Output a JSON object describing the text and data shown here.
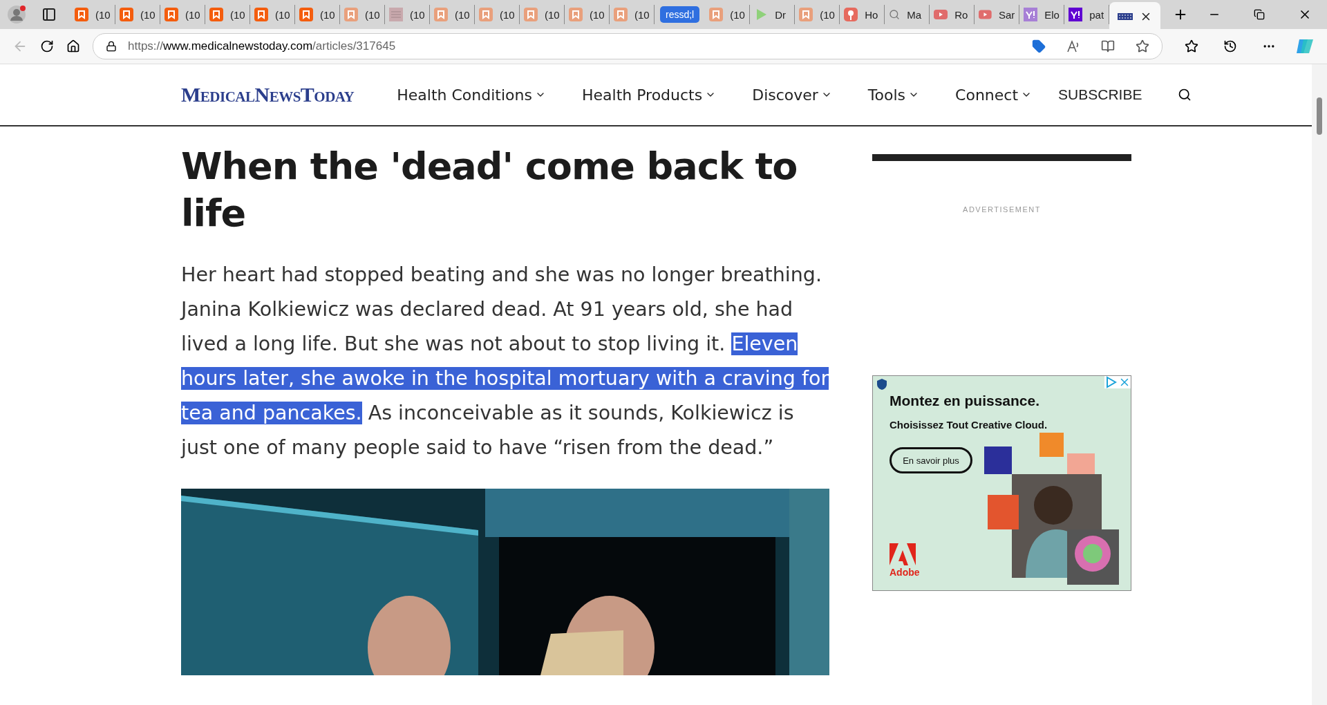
{
  "tabs": [
    {
      "kind": "bookmark",
      "label": "(10",
      "selected": false
    },
    {
      "kind": "bookmark",
      "label": "(10",
      "selected": false
    },
    {
      "kind": "bookmark",
      "label": "(10",
      "selected": false
    },
    {
      "kind": "bookmark",
      "label": "(10",
      "selected": false
    },
    {
      "kind": "bookmark",
      "label": "(10",
      "selected": false
    },
    {
      "kind": "bookmark",
      "label": "(10",
      "selected": false
    },
    {
      "kind": "faded",
      "label": "(10",
      "selected": false
    },
    {
      "kind": "thumbnail",
      "label": "(10",
      "selected": false
    },
    {
      "kind": "faded",
      "label": "(10",
      "selected": false
    },
    {
      "kind": "faded",
      "label": "(10",
      "selected": false
    },
    {
      "kind": "faded",
      "label": "(10",
      "selected": false
    },
    {
      "kind": "faded",
      "label": "(10",
      "selected": false
    },
    {
      "kind": "faded",
      "label": "(10",
      "selected": false
    },
    {
      "kind": "group",
      "label": "ressd;l",
      "selected": false
    },
    {
      "kind": "faded",
      "label": "(10",
      "selected": false
    },
    {
      "kind": "play",
      "label": "Dr",
      "selected": false
    },
    {
      "kind": "faded",
      "label": "(10",
      "selected": false
    },
    {
      "kind": "pin",
      "label": "Ho",
      "selected": false
    },
    {
      "kind": "search",
      "label": "Ma",
      "selected": false
    },
    {
      "kind": "video",
      "label": "Ro",
      "selected": false
    },
    {
      "kind": "video",
      "label": "Sar",
      "selected": false
    },
    {
      "kind": "light",
      "label": "Elo",
      "selected": false
    },
    {
      "kind": "yahoo",
      "label": "pat",
      "selected": false
    },
    {
      "kind": "site",
      "selected": true
    }
  ],
  "address_bar": {
    "scheme": "https://",
    "host": "www.medicalnewstoday.com",
    "path": "/articles/317645"
  },
  "site": {
    "logo": "MedicalNewsToday",
    "nav": [
      "Health Conditions",
      "Health Products",
      "Discover",
      "Tools",
      "Connect"
    ],
    "subscribe": "SUBSCRIBE"
  },
  "article": {
    "title": "When the 'dead' come back to life",
    "paragraph": [
      {
        "text": "Her heart had stopped beating and she was no longer breathing. Janina Kolkiewicz was declared dead. At 91 years old, she had lived a long life. But she was not about to stop living it. ",
        "selected": false
      },
      {
        "text": "Eleven hours later, she awoke in the hospital mortuary with a craving for tea and pancakes.",
        "selected": true
      },
      {
        "text": " As inconceivable as it sounds, Kolkiewicz is just one of many people said to have “risen from the dead.”",
        "selected": false
      }
    ]
  },
  "sidebar": {
    "ad_label": "ADVERTISEMENT",
    "ad": {
      "headline": "Montez en puissance.",
      "subline": "Choisissez Tout Creative Cloud.",
      "button": "En savoir plus",
      "brand": "Adobe"
    }
  }
}
